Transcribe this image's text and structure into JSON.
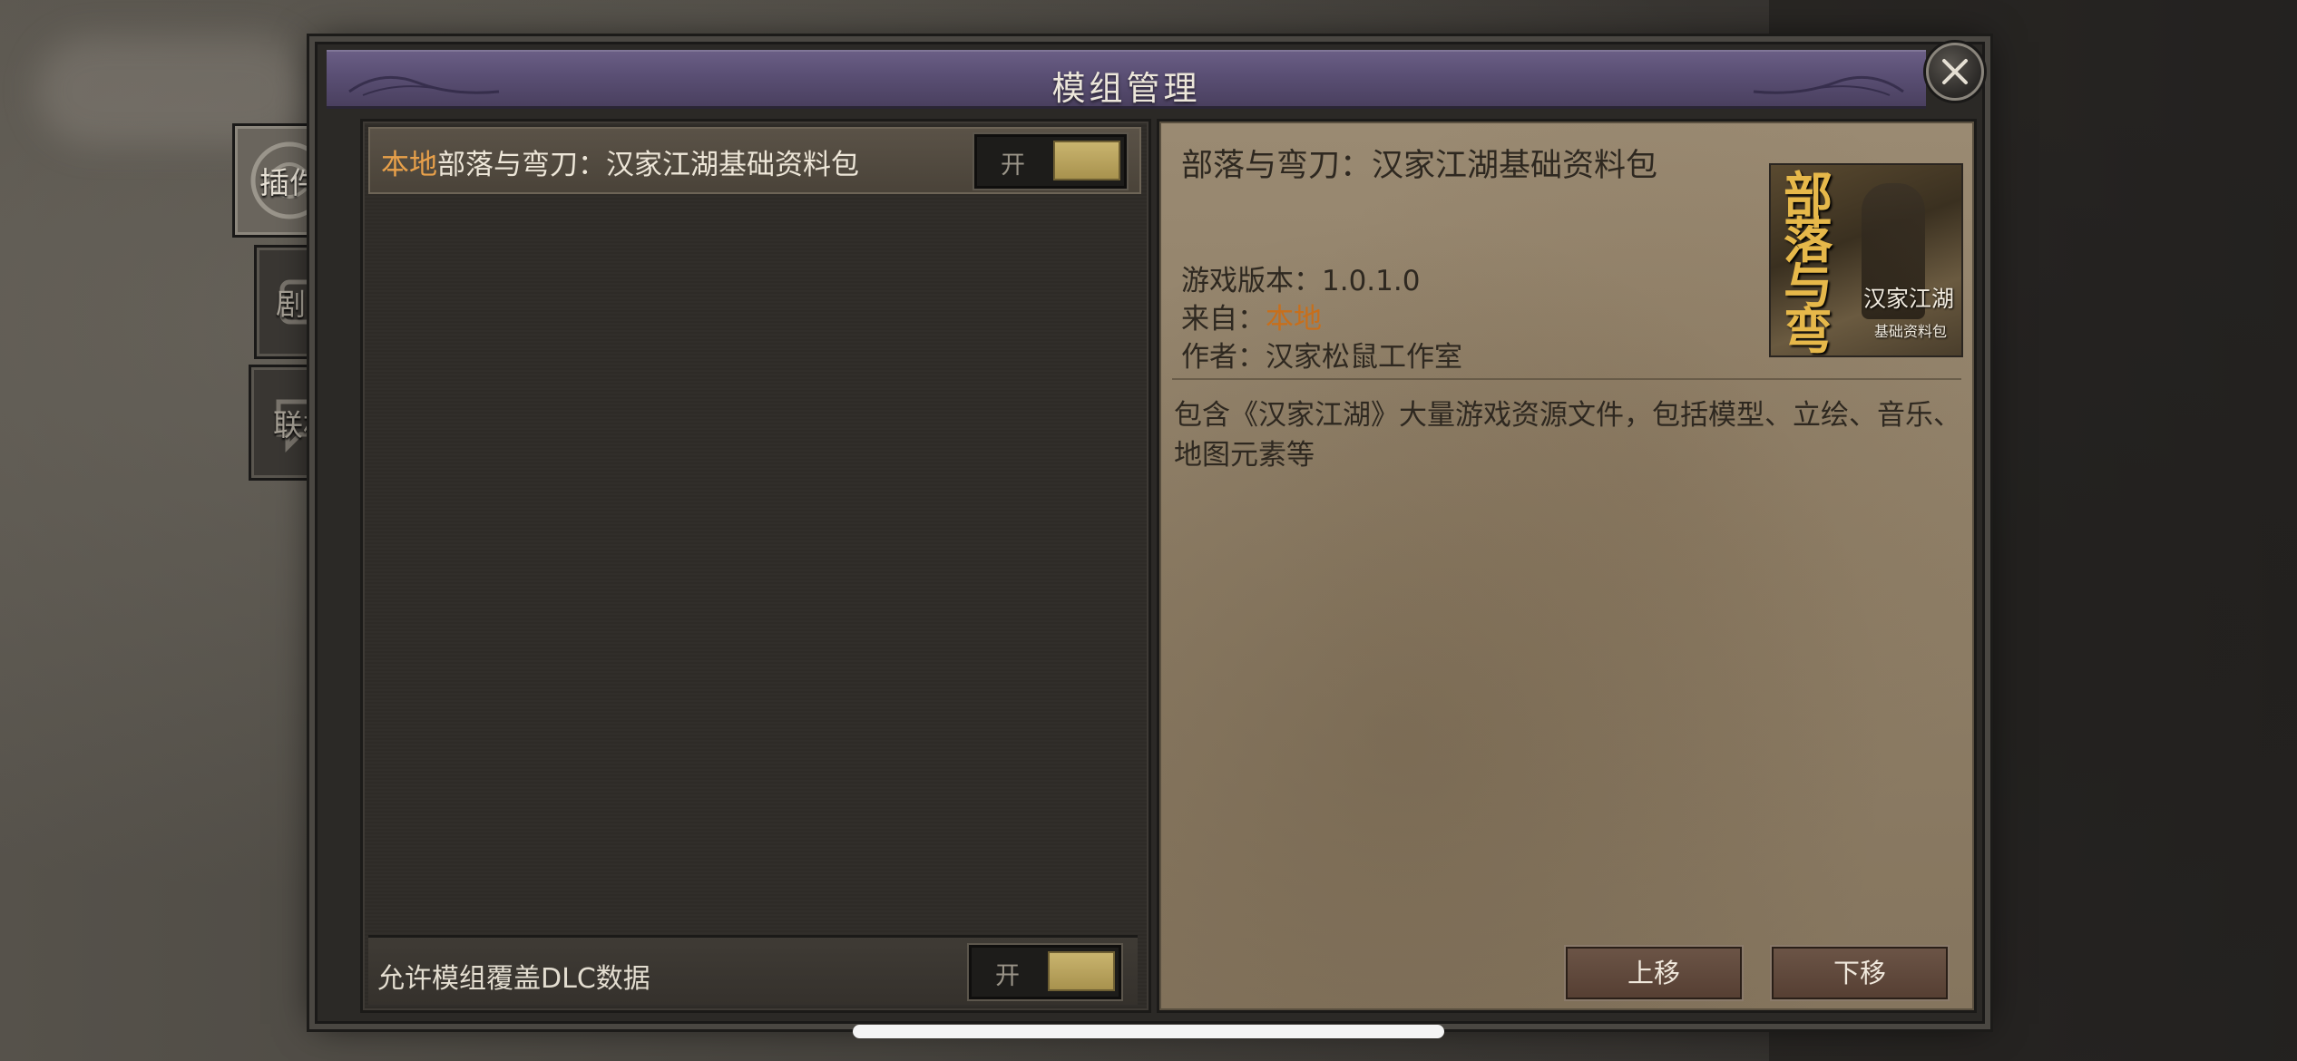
{
  "dialog": {
    "title": "模组管理"
  },
  "tabs": [
    {
      "label": "插件",
      "active": true
    },
    {
      "label": "剧本",
      "active": false
    },
    {
      "label": "联机",
      "active": false
    }
  ],
  "mod_list": {
    "items": [
      {
        "source_tag": "本地",
        "name": "部落与弯刀：汉家江湖基础资料包",
        "toggle_label": "开",
        "enabled": true
      }
    ]
  },
  "dlc_override": {
    "label": "允许模组覆盖DLC数据",
    "toggle_label": "开",
    "enabled": true
  },
  "details": {
    "title": "部落与弯刀：汉家江湖基础资料包",
    "version_label": "游戏版本：",
    "version_value": "1.0.1.0",
    "source_label": "来自：",
    "source_value": "本地",
    "author_label": "作者：",
    "author_value": "汉家松鼠工作室",
    "description": "包含《汉家江湖》大量游戏资源文件，包括模型、立绘、音乐、地图元素等",
    "cover": {
      "title": "部落与弯刀",
      "subtitle": "汉家江湖",
      "caption": "基础资料包"
    }
  },
  "buttons": {
    "move_up": "上移",
    "move_down": "下移"
  },
  "colors": {
    "accent_local": "#e8a04a",
    "title_bar": "#5a4f74",
    "toggle_on": "#b8a25c"
  }
}
